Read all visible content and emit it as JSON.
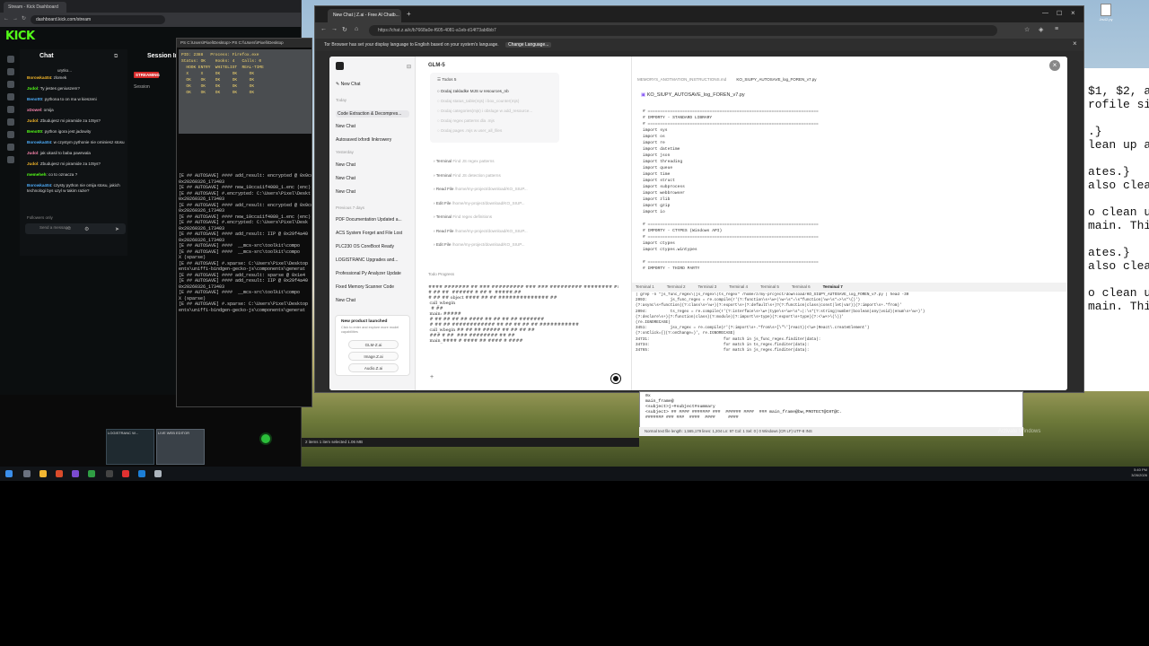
{
  "kick_browser": {
    "tabs": [
      "Stream - Kick Dashboard"
    ],
    "url": "dashboard.kick.com/stream",
    "logo": "KICK",
    "chat_title": "Chat",
    "chat_user_badge": "urytko...",
    "messages": [
      {
        "user": "Borowka404",
        "text": "zlomek"
      },
      {
        "user": "Judol",
        "text": "Ty jestes geniuszem?"
      },
      {
        "user": "Benott0",
        "text": "pythona to on ma w kieszeni"
      },
      {
        "user": "xDowel",
        "text": "omija"
      },
      {
        "user": "Judol",
        "text": "Zbudujesz mi piramide za 10tys?"
      },
      {
        "user": "Benott0",
        "text": "python igora jest jadowity"
      },
      {
        "user": "Borowka404",
        "text": "w czystym pythonie nie ominiesz stosu"
      },
      {
        "user": "Judol",
        "text": "jak ukasil to baba pawrwala"
      },
      {
        "user": "Judol",
        "text": "Zbudujesz mi piramide za 10tys?"
      },
      {
        "user": "memeheh",
        "text": "co to oznacza ?"
      },
      {
        "user": "Borowka404",
        "text": "czysty python nie omija stosu, jakich technologi bys uzyl w takim razie?"
      }
    ],
    "followers_only": "Followers only",
    "send_placeholder": "Send a message",
    "session_title": "Session In",
    "streaming_badge": "STREAMING",
    "session_label": "Session"
  },
  "terminal": {
    "title": "PS C:\\Users\\Pixel\\Desktop>  PS C:\\\\Users\\\\Pixel\\\\Desktop",
    "monitor": "PID: 2388   Process: Firefox.exe\nStatus: OK    Hooks: 4   Calls: 0\n  HOOK ENTRY  WHITELIST  REAL-TIME\n  X     X     OK     OK     OK\n  OK    OK    OK     OK     OK\n  OK    OK    OK     OK     OK\n  OK    OK    OK     OK     OK",
    "log": "[E ## AUTOSAVE] #### add_result: encrypted @ 0x0cca\n0x20260326_173403\n[E ## AUTOSAVE] #### new_10cca11f4080_1.enc (enc)\n[E ## AUTOSAVE] #.encrypted: C:\\Users\\Pixel\\Deskt\n0x20260326_173403\n[E ## AUTOSAVE] #### add_result: encrypted @ 0x0cca\n0x20260326_173403\n[E ## AUTOSAVE] #### new_10cca11f4080_1.enc (enc)\n[E ## AUTOSAVE] #.encrypted: C:\\Users\\Pixel\\Desk\n0x20260326_173403\n[E ## AUTOSAVE] #### add_result: IIP @ 0x29f4a40\n0x20260326_173403\n[E ## AUTOSAVE] ####  __mcs-src\\toolkit\\compo\n[E ## AUTOSAVE] ####  __mcs-src\\toolkit\\compo\nX (sparse)\n[E ## AUTOSAVE] #.sparse: C:\\Users\\Pixel\\Desktop\nents\\uniffi-bindgen-gecko-js\\components\\generat\n[E ## AUTOSAVE] #### add_result: sparse @ 0x1e4\n[E ## AUTOSAVE] #### add_result: IIP @ 0x29f4a40\n0x20260326_173403\n[E ## AUTOSAVE] ####  __mcs-src\\toolkit\\compo\nX (sparse)\n[E ## AUTOSAVE] #.sparse: C:\\Users\\Pixel\\Desktop\nents\\uniffi-bindgen-gecko-js\\components\\generat"
  },
  "main_browser": {
    "tab_title": "New Chat | Z.ai - Free AI Chatb...",
    "url": "https://chat.z.ai/c/b7668a0e-f605-4081-a1eb-d14f73ab6bb7",
    "infobar_text": "Tor Browser has set your display language to English based on your system's language.",
    "change_language": "Change Language...",
    "close": "×"
  },
  "sidebar": {
    "new_chat": "New Chat",
    "today_label": "Today",
    "today_items": [
      "Code Extraction & Decompres...",
      "New Chat",
      "Autosaved ixfordi linkrowery"
    ],
    "yesterday_label": "Yesterday",
    "yesterday_items": [
      "New Chat",
      "New Chat",
      "New Chat"
    ],
    "previous_label": "Previous 7 days",
    "previous_items": [
      "PDF Documentation Updated a...",
      "ACS System Forget and File Lost",
      "PLC230 OS CoreBoot Ready",
      "LOGISTRANC Upgrades and...",
      "Professional Py Analyzer Update",
      "Fixed Memory Scanner Code",
      "New Chat"
    ],
    "card_title": "New product launched",
    "card_text": "Click to enter and explore more model capabilities",
    "chips": [
      "GLM-Z.ai",
      "Image.Z.ai",
      "Audio.Z.ai"
    ]
  },
  "conversation": {
    "model": "GLM-5",
    "todos_label": "Todos",
    "todos_count": "5",
    "todos": [
      "Dodaj zakladke MJS w resources_nb",
      "Dodaj status_table(mjs) i box_counter(mjs)",
      "Dodaj categories(mjs) i obsluge w add_resource...",
      "Dodaj regex patterns dla .mjs",
      "Dodaj pages .mjs w user_all_files"
    ],
    "tools": [
      {
        "name": "Terminal",
        "detail": "Find JS regex patterns"
      },
      {
        "name": "Terminal",
        "detail": "Find JS detection patterns"
      },
      {
        "name": "Read File",
        "detail": "/home/my-project/download/KO_SIUP..."
      },
      {
        "name": "Edit File",
        "detail": "/home/my-project/download/KO_SIUP..."
      },
      {
        "name": "Terminal",
        "detail": "Find regex definitions"
      },
      {
        "name": "Read File",
        "detail": "/home/my-project/download/KO_SIUP..."
      },
      {
        "name": "Edit File",
        "detail": "/home/my-project/download/KO_SIUP..."
      }
    ],
    "todo_progress": "Todo Progress",
    "garbled": "#### ####### ## ### ######### ### ### ######### ######## #####\n# ## ##  ###### # ## #  #####.##\n# ## ## object #### ## ## ############## ##\n call_wbegin\n  # ##\n main: #####\n # ## ## ## ## #### ## ## ## ## #######\n # ## ## ############ ## ## ## ## ## ###########\n call_wbegin ## ## ## ##### ## ## ## ##\n ### # ##  ### ######## ## ##\n main_#### # #### ## #### # ####"
  },
  "viewer": {
    "tabs": [
      "MEMORYS_ANOTMATION_INSTRUCTIONS.md",
      "KO_SIUPY_AUTOSAVE_log_FOREN_v7.py"
    ],
    "filename": "KO_SIUPY_AUTOSAVE_log_FOREN_v7.py",
    "code": "# =====================================================================\n# IMPORTY - STANDARD LIBRARY\n# =====================================================================\nimport sys\nimport os\nimport re\nimport datetime\nimport json\nimport threading\nimport queue\nimport time\nimport struct\nimport subprocess\nimport webbrowser\nimport zlib\nimport gzip\nimport io\n\n# =====================================================================\n# IMPORTY - CTYPES (Windows API)\n# =====================================================================\nimport ctypes\nimport ctypes.wintypes\n\n# =====================================================================\n# IMPORTY - THIRD PARTY",
    "terminal_tabs": [
      "Terminal 1",
      "Terminal 2",
      "Terminal 3",
      "Terminal 4",
      "Terminal 5",
      "Terminal 6",
      "Terminal 7"
    ],
    "terminal_output": "| grep -n \"js_func_regex\\|js_regex\\|ts_regex\" /home/z/my-project/download/KO_SIUPY_AUTOSAVE_log_FOREN_v7.py | head -30\n2093:          js_func_regex = re.compile(r'(?:function\\s+\\w+|\\w+\\s*=\\s*function|\\w+\\s*=>\\s*\\{)')\n(?:async\\s+function)(?:class\\s+\\w+)(?:export\\s+(?:default\\s+)?(?:function|class|const|let|var))(?:import\\s+.*from)'\n2094:          ts_regex = re.compile(r'(?:interface\\s+\\w+|type\\s+\\w+\\s*=|:\\s*(?:string|number|boolean|any|void)|enum\\s+\\w+)')\n(?:declare\\s+)(?:function|class)(?:module)(?:import\\s+type)(?:export\\s+type)(?:<\\w+>\\(\\))'\n(re.IGNORECASE)\n3451:          jsx_regex = re.compile(r'(?:import\\s+.*from\\s+[\\\"\\']react)|<\\w+|React\\.createElement')\n(?:onClick={)(?:onChange=)', re.IGNORECASE)\n34731:                                for match in js_func_regex.finditer(data):\n34734:                                for match in ts_regex.finditer(data):\n34765:                                for match in js_regex.finditer(data):"
  },
  "hex_editor": {
    "lines": "0x\nmain_frame@\n<subject>j~#subject#summary\n<subject> ## #### ####### ###  ###### ####  ### main_frame@bw,PROTECT@C0T@C.\n####### ### ###  ####  ####     ####",
    "status": "Normal text file     length: 1,565,179    lines: 1,204    Ln: 97    Col: 1    Sel: 0 | 0    Windows (CR LF)    UTF-8    INS"
  },
  "explorer_status": "2 items   1 item selected  1.06 MB",
  "activate_windows": "Activate Windows",
  "right_editor_text": "$1, $2, an\nrofile sign\n\n.}\nlean up any\n\nates.}\nalso clean\n\no clean up\nmain. This\n\nates.}\nalso clean\n\no clean up\nmain. This",
  "desktop_icon": "Jrs42.py",
  "taskbar": {
    "time": "5:40 PM",
    "date": "3/26/2026"
  },
  "thumbnails": [
    "LOGISTRANC W...",
    "LIVE WEB EDITOR"
  ]
}
